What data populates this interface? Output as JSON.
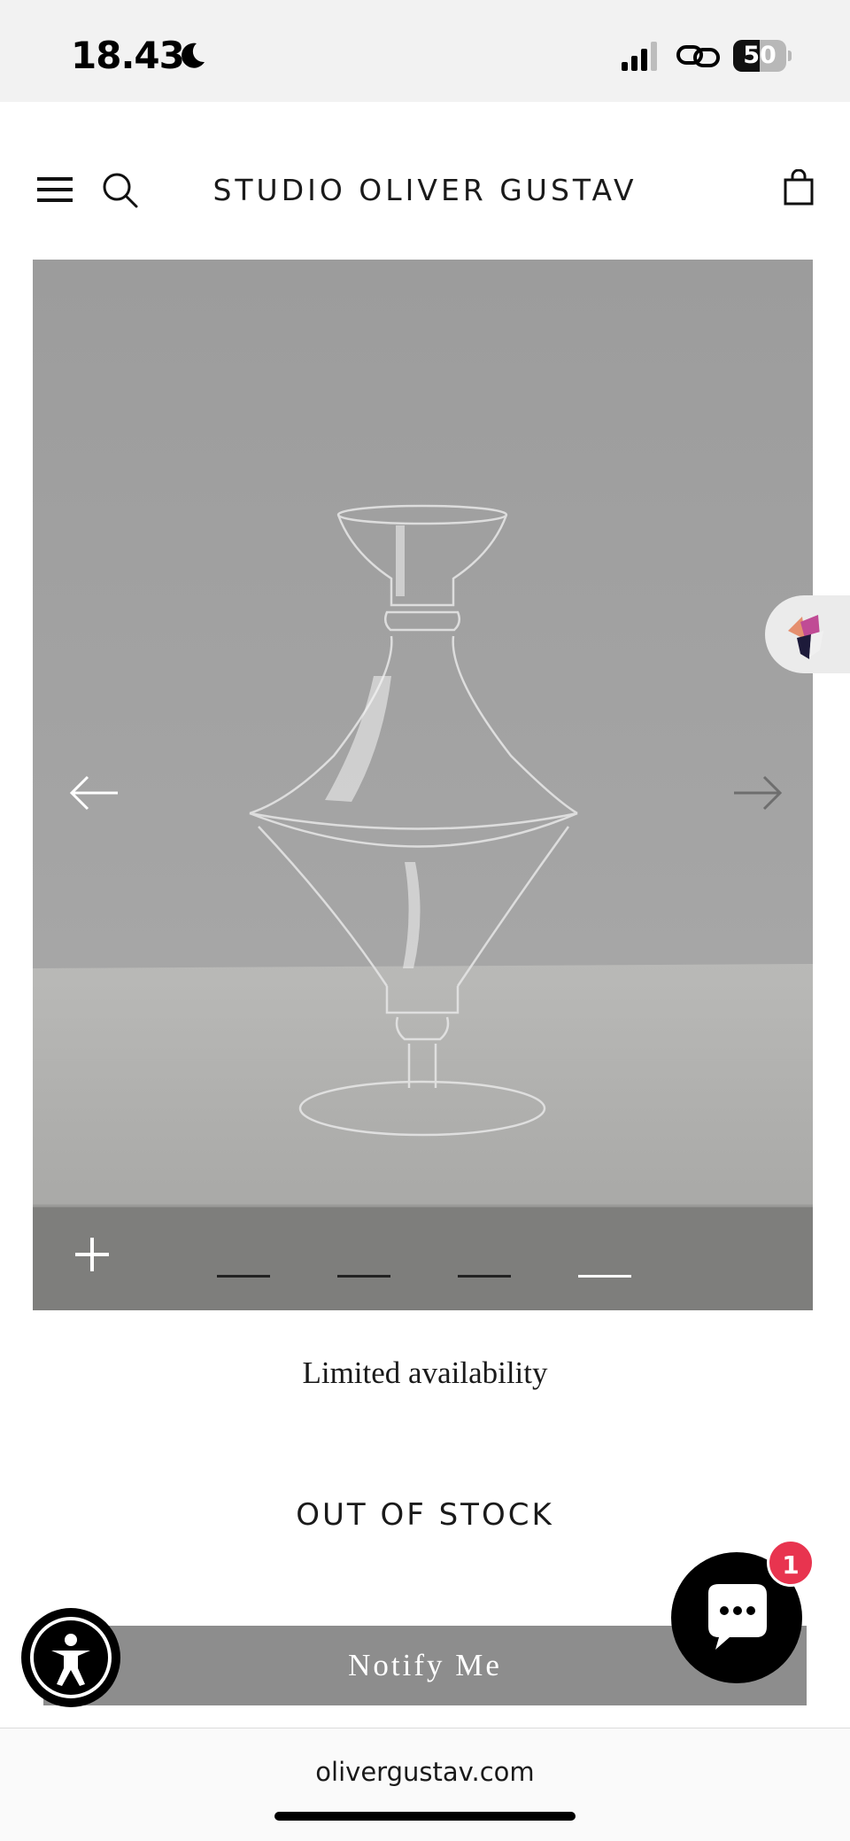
{
  "status_bar": {
    "time": "18.43",
    "battery_level": "50",
    "battery_fraction": 0.5
  },
  "header": {
    "brand": "STUDIO OLIVER GUSTAV",
    "icons": [
      "menu-icon",
      "search-icon",
      "cart-icon"
    ]
  },
  "gallery": {
    "slide_count": 4,
    "active_slide": 4,
    "icons": [
      "arrow-left-icon",
      "arrow-right-icon",
      "plus-icon"
    ],
    "background_color": "#a1a1a1"
  },
  "product": {
    "availability": "Limited availability",
    "stock_status": "OUT OF STOCK",
    "notify_label": "Notify Me"
  },
  "widgets": {
    "chat_badge_count": "1",
    "chat_badge_color": "#e8344f",
    "icons": [
      "accessibility-icon",
      "chat-icon"
    ]
  },
  "browser": {
    "url": "olivergustav.com"
  }
}
